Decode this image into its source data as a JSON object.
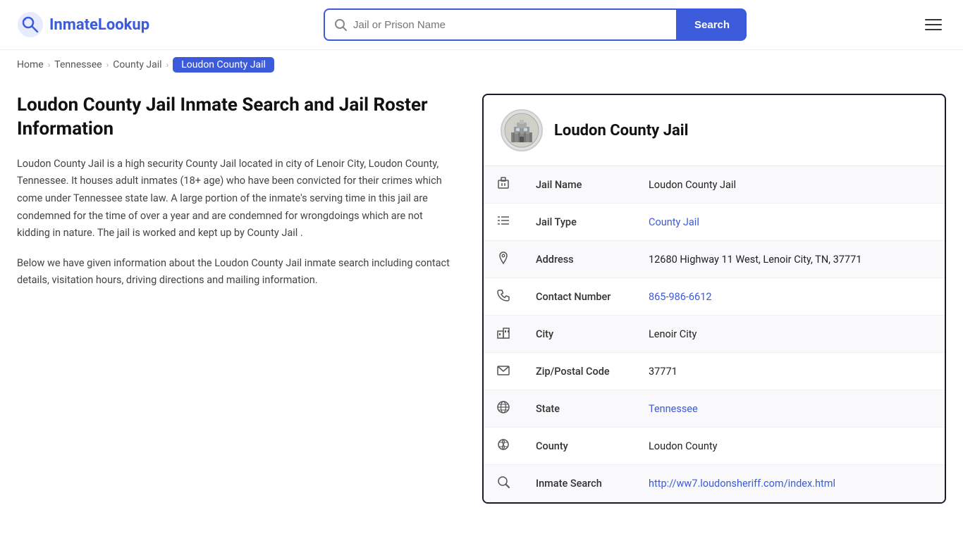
{
  "header": {
    "logo_name": "InmateLookup",
    "logo_accent": "Inmate",
    "search_placeholder": "Jail or Prison Name",
    "search_button_label": "Search",
    "menu_label": "Menu"
  },
  "breadcrumb": {
    "items": [
      {
        "label": "Home",
        "href": "#",
        "active": false
      },
      {
        "label": "Tennessee",
        "href": "#",
        "active": false
      },
      {
        "label": "County Jail",
        "href": "#",
        "active": false
      },
      {
        "label": "Loudon County Jail",
        "href": "#",
        "active": true
      }
    ]
  },
  "left": {
    "page_title": "Loudon County Jail Inmate Search and Jail Roster Information",
    "description1": "Loudon County Jail is a high security County Jail located in city of Lenoir City, Loudon County, Tennessee. It houses adult inmates (18+ age) who have been convicted for their crimes which come under Tennessee state law. A large portion of the inmate's serving time in this jail are condemned for the time of over a year and are condemned for wrongdoings which are not kidding in nature. The jail is worked and kept up by County Jail .",
    "description2": "Below we have given information about the Loudon County Jail inmate search including contact details, visitation hours, driving directions and mailing information."
  },
  "card": {
    "jail_name": "Loudon County Jail",
    "rows": [
      {
        "icon": "jail",
        "label": "Jail Name",
        "value": "Loudon County Jail",
        "link": null
      },
      {
        "icon": "list",
        "label": "Jail Type",
        "value": "County Jail",
        "link": "#"
      },
      {
        "icon": "pin",
        "label": "Address",
        "value": "12680 Highway 11 West, Lenoir City, TN, 37771",
        "link": null
      },
      {
        "icon": "phone",
        "label": "Contact Number",
        "value": "865-986-6612",
        "link": "tel:865-986-6612"
      },
      {
        "icon": "city",
        "label": "City",
        "value": "Lenoir City",
        "link": null
      },
      {
        "icon": "mail",
        "label": "Zip/Postal Code",
        "value": "37771",
        "link": null
      },
      {
        "icon": "globe",
        "label": "State",
        "value": "Tennessee",
        "link": "#"
      },
      {
        "icon": "county",
        "label": "County",
        "value": "Loudon County",
        "link": null
      },
      {
        "icon": "search",
        "label": "Inmate Search",
        "value": "http://ww7.loudonsheriff.com/index.html",
        "link": "http://ww7.loudonsheriff.com/index.html"
      }
    ]
  }
}
